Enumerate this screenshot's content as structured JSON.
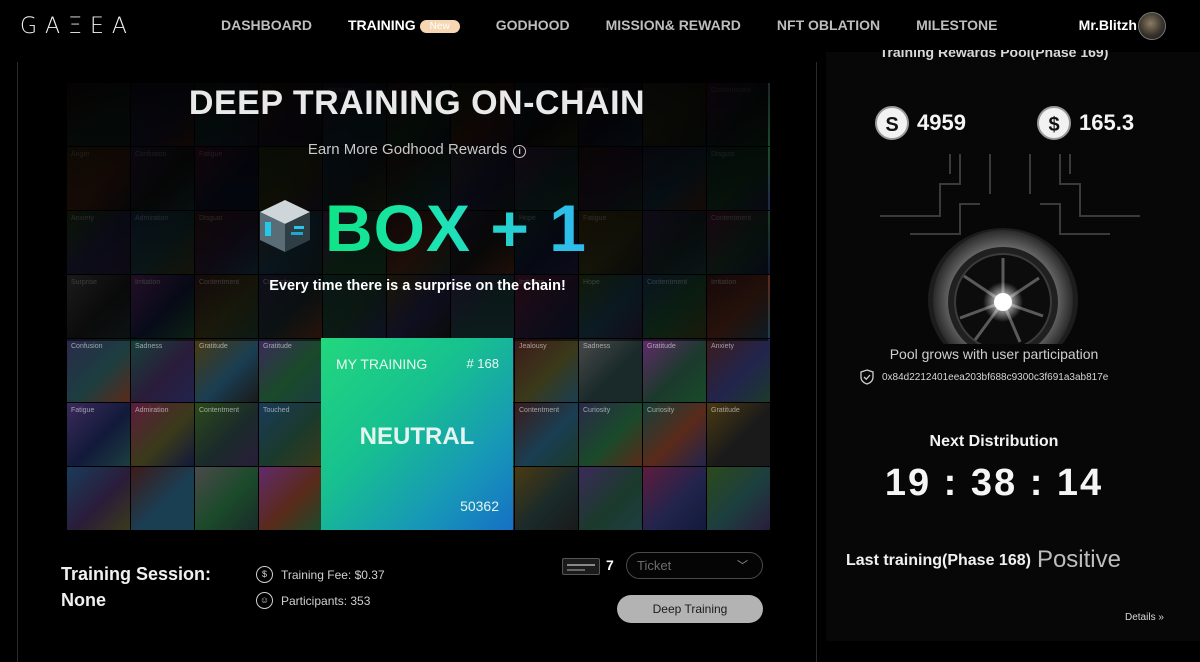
{
  "brand": {
    "logo_text": "GAΞEA"
  },
  "nav": {
    "items": [
      {
        "label": "DASHBOARD"
      },
      {
        "label": "TRAINING",
        "badge": "New"
      },
      {
        "label": "GODHOOD"
      },
      {
        "label": "MISSION& REWARD"
      },
      {
        "label": "NFT OBLATION"
      },
      {
        "label": "MILESTONE"
      }
    ],
    "active": "TRAINING"
  },
  "user": {
    "name": "Mr.Blitzh"
  },
  "hero": {
    "title": "DEEP TRAINING ON-CHAIN",
    "subtitle": "Earn More Godhood Rewards",
    "box_text": "BOX + 1",
    "surprise_text": "Every time there is a surprise on the chain!"
  },
  "emotion_grid": [
    [
      "",
      "",
      "",
      "",
      "Irritation",
      "",
      "",
      "",
      "Irritation",
      "",
      "Contentment"
    ],
    [
      "Anger",
      "Confusion",
      "Fatigue",
      "",
      "",
      "",
      "",
      "",
      "",
      "",
      "Disgust"
    ],
    [
      "Anxiety",
      "Admiration",
      "Disgust",
      "",
      "",
      "",
      "",
      "Hope",
      "Fatigue",
      "",
      "Contentment"
    ],
    [
      "Surprise",
      "Irritation",
      "Contentment",
      "Curiosity",
      "",
      "",
      "",
      "Irritation",
      "Hope",
      "Contentment",
      "Irritation"
    ],
    [
      "Confusion",
      "Sadness",
      "Gratitude",
      "Gratitude",
      "",
      "",
      "",
      "Jealousy",
      "Sadness",
      "Gratitude",
      "Anxiety"
    ],
    [
      "Fatigue",
      "Admiration",
      "Contentment",
      "Touched",
      "",
      "",
      "",
      "Contentment",
      "Curiosity",
      "Curiosity",
      "Gratitude"
    ],
    [
      "",
      "",
      "",
      "",
      "",
      "",
      "",
      "",
      "",
      "",
      ""
    ]
  ],
  "my_training": {
    "label": "MY TRAINING",
    "number": "# 168",
    "mood": "NEUTRAL",
    "count": "50362"
  },
  "session": {
    "label": "Training Session:",
    "value": "None",
    "fee_label": "Training Fee: $0.37",
    "participants_label": "Participants: 353"
  },
  "ticket": {
    "count": "7",
    "placeholder": "Ticket"
  },
  "deep_button": "Deep Training",
  "pool": {
    "title": "Training Rewards Pool(Phase 169)",
    "token1_value": "4959",
    "token2_value": "165.3",
    "note": "Pool grows with user participation",
    "address": "0x84d2212401eea203bf688c9300c3f691a3ab817e"
  },
  "distribution": {
    "label": "Next Distribution",
    "timer": "19 : 38 : 14"
  },
  "last_training": {
    "label": "Last training(Phase 168)",
    "value": "Positive"
  },
  "details_link": "Details",
  "colors": {
    "accent_green": "#0fe486",
    "accent_blue": "#2fb9f1",
    "badge": "#f6d6b3",
    "button_bg": "#b3b3b3"
  }
}
